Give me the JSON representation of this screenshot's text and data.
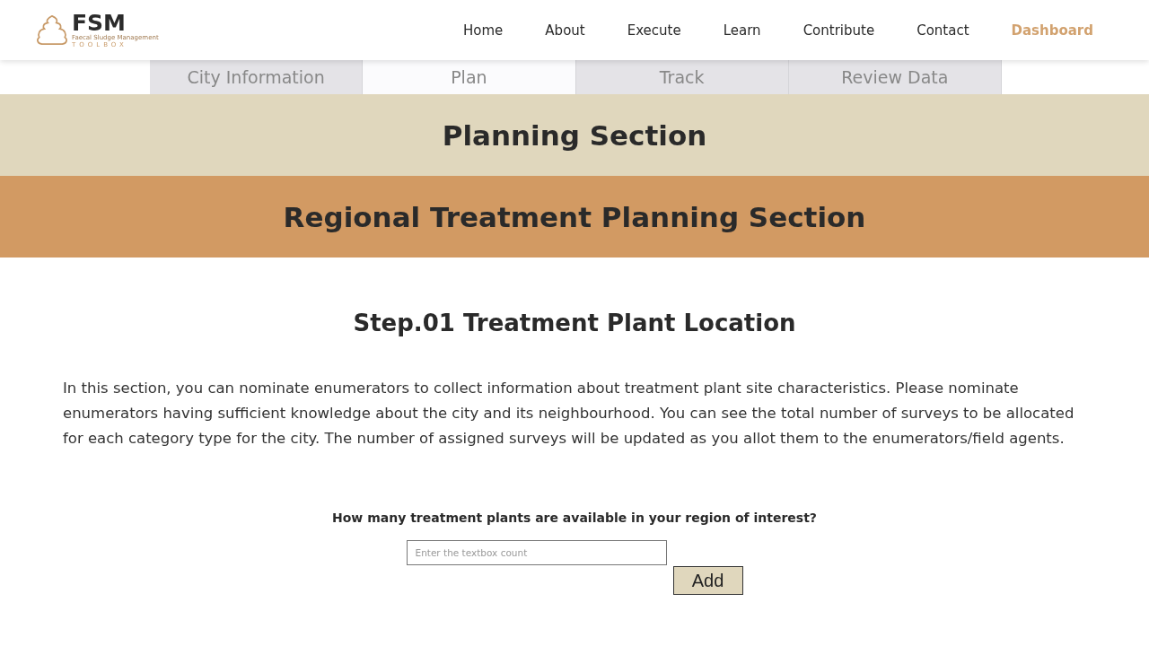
{
  "logo": {
    "title": "FSM",
    "subtitle": "Faecal Sludge Management",
    "tagline": "TOOLBOX"
  },
  "nav": [
    {
      "label": "Home",
      "selected": false
    },
    {
      "label": "About",
      "selected": false
    },
    {
      "label": "Execute",
      "selected": false
    },
    {
      "label": "Learn",
      "selected": false
    },
    {
      "label": "Contribute",
      "selected": false
    },
    {
      "label": "Contact",
      "selected": false
    },
    {
      "label": "Dashboard",
      "selected": true
    }
  ],
  "tabs": [
    {
      "label": "City Information",
      "selected": false
    },
    {
      "label": "Plan",
      "selected": true
    },
    {
      "label": "Track",
      "selected": false
    },
    {
      "label": "Review Data",
      "selected": false
    }
  ],
  "section_title": "Planning Section",
  "subsection_title": "Regional Treatment Planning Section",
  "step_title": "Step.01 Treatment Plant Location",
  "description": "In this section, you can nominate enumerators to collect information about treatment plant site characteristics. Please nominate enumerators having sufficient knowledge about the city and its neighbourhood. You can see the total number of surveys to be allocated for each category type for the city. The number of assigned surveys will be updated as you allot them to the enumerators/field agents.",
  "question": "How many treatment plants are available in your region of interest?",
  "count_field": {
    "placeholder": "Enter the textbox count"
  },
  "add_button": "Add"
}
